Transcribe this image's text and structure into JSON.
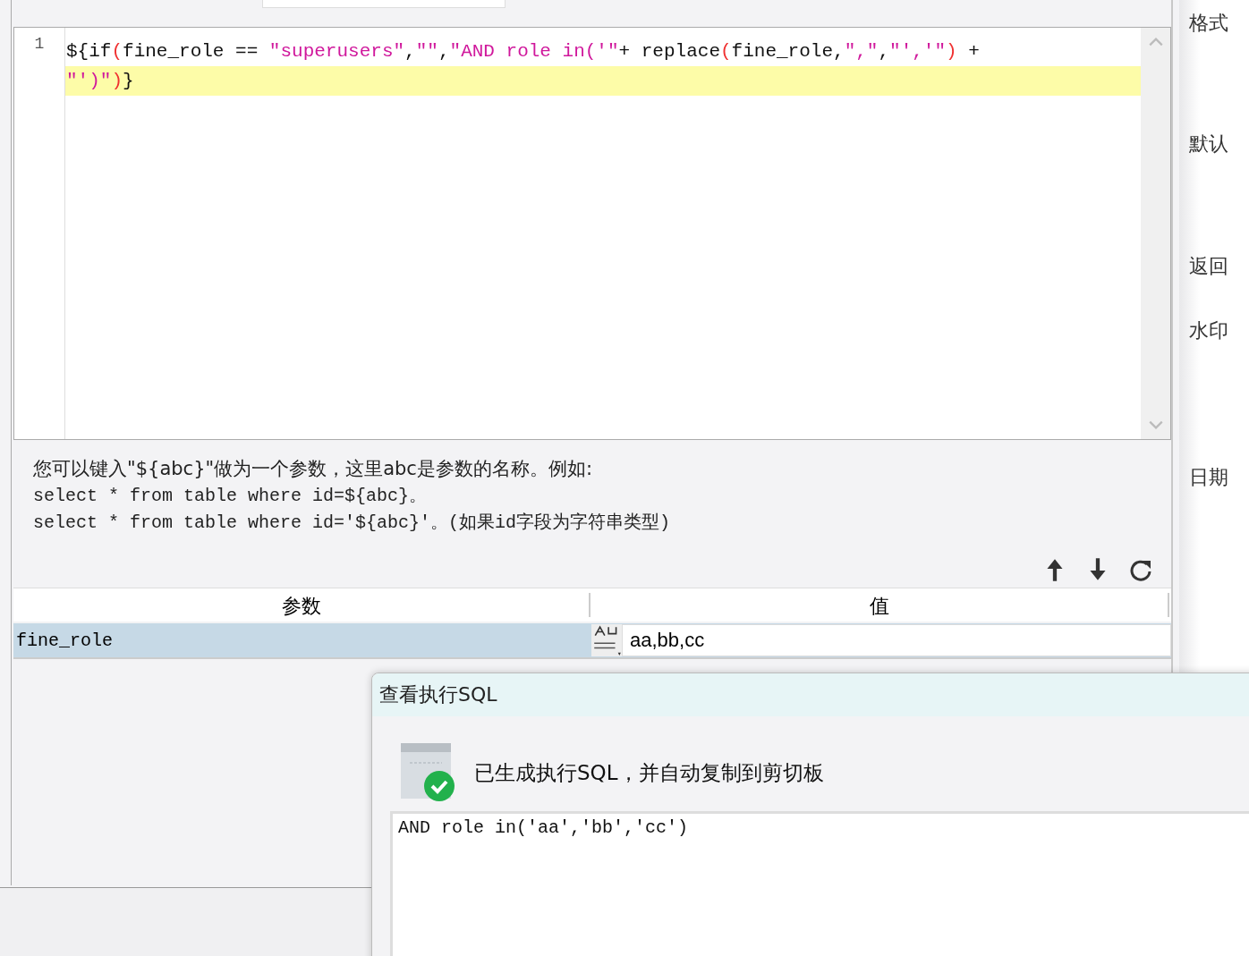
{
  "editor": {
    "line_number": "1",
    "wrapped_lines": [
      [
        {
          "kind": "plain",
          "text": "${if"
        },
        {
          "kind": "paren",
          "text": "("
        },
        {
          "kind": "plain",
          "text": "fine_role == "
        },
        {
          "kind": "string",
          "text": "\"superusers\""
        },
        {
          "kind": "plain",
          "text": ","
        },
        {
          "kind": "string",
          "text": "\"\""
        },
        {
          "kind": "plain",
          "text": ","
        },
        {
          "kind": "string",
          "text": "\"AND role in('\""
        },
        {
          "kind": "plain",
          "text": "+ replace"
        },
        {
          "kind": "paren",
          "text": "("
        },
        {
          "kind": "plain",
          "text": "fine_role,"
        },
        {
          "kind": "string",
          "text": "\",\""
        },
        {
          "kind": "plain",
          "text": ","
        },
        {
          "kind": "string",
          "text": "\"','\""
        },
        {
          "kind": "paren",
          "text": ")"
        },
        {
          "kind": "plain",
          "text": " +"
        }
      ],
      [
        {
          "kind": "string",
          "text": "\"')\""
        },
        {
          "kind": "paren",
          "text": ")"
        },
        {
          "kind": "plain",
          "text": "}"
        }
      ]
    ]
  },
  "help": [
    "您可以键入\"${abc}\"做为一个参数，这里abc是参数的名称。例如:",
    "select * from table where id=${abc}。",
    "select * from table where id='${abc}'。(如果id字段为字符串类型)"
  ],
  "params_table": {
    "columns": [
      "参数",
      "值"
    ],
    "rows": [
      {
        "name": "fine_role",
        "value": "aa,bb,cc",
        "selected": true
      }
    ]
  },
  "side_labels": [
    "格式",
    "默认",
    "返回",
    "水印",
    "日期"
  ],
  "dialog": {
    "title": "查看执行SQL",
    "message": "已生成执行SQL，并自动复制到剪切板",
    "sql": "AND role in('aa','bb','cc')"
  }
}
